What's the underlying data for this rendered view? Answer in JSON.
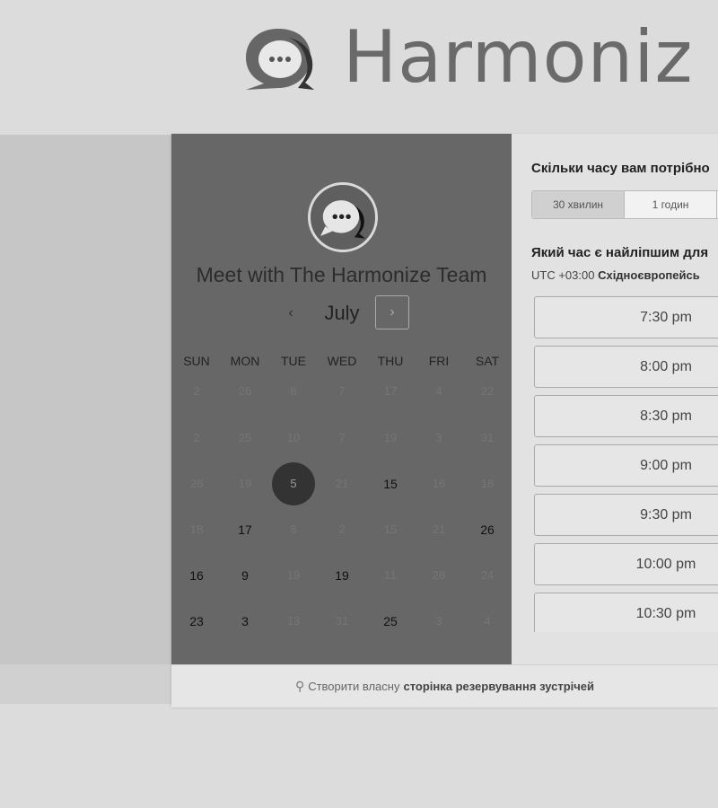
{
  "brand": {
    "name": "Harmoniz"
  },
  "widget": {
    "title": "Meet with The Harmonize Team",
    "month": "July",
    "prev_glyph": "‹",
    "next_glyph": "›",
    "days_of_week": [
      "SUN",
      "MON",
      "TUE",
      "WED",
      "THU",
      "FRI",
      "SAT"
    ],
    "calendar_rows": [
      [
        {
          "d": "2",
          "s": "muted"
        },
        {
          "d": "26",
          "s": "muted"
        },
        {
          "d": "8",
          "s": "muted"
        },
        {
          "d": "7",
          "s": "muted"
        },
        {
          "d": "17",
          "s": "muted"
        },
        {
          "d": "4",
          "s": "muted"
        },
        {
          "d": "22",
          "s": "muted"
        }
      ],
      [
        {
          "d": "2",
          "s": "muted"
        },
        {
          "d": "25",
          "s": "muted"
        },
        {
          "d": "10",
          "s": "muted"
        },
        {
          "d": "7",
          "s": "muted"
        },
        {
          "d": "19",
          "s": "muted"
        },
        {
          "d": "3",
          "s": "muted"
        },
        {
          "d": "31",
          "s": "muted"
        }
      ],
      [
        {
          "d": "26",
          "s": "muted"
        },
        {
          "d": "19",
          "s": "muted"
        },
        {
          "d": "5",
          "s": "selected"
        },
        {
          "d": "21",
          "s": "muted"
        },
        {
          "d": "15",
          "s": "avail"
        },
        {
          "d": "16",
          "s": "muted"
        },
        {
          "d": "18",
          "s": "muted"
        }
      ],
      [
        {
          "d": "18",
          "s": "muted"
        },
        {
          "d": "17",
          "s": "avail"
        },
        {
          "d": "8",
          "s": "muted"
        },
        {
          "d": "2",
          "s": "muted"
        },
        {
          "d": "15",
          "s": "muted"
        },
        {
          "d": "21",
          "s": "muted"
        },
        {
          "d": "26",
          "s": "avail"
        }
      ],
      [
        {
          "d": "16",
          "s": "avail"
        },
        {
          "d": "9",
          "s": "avail"
        },
        {
          "d": "19",
          "s": "muted"
        },
        {
          "d": "19",
          "s": "avail"
        },
        {
          "d": "11",
          "s": "muted"
        },
        {
          "d": "28",
          "s": "muted"
        },
        {
          "d": "24",
          "s": "muted"
        }
      ],
      [
        {
          "d": "23",
          "s": "avail"
        },
        {
          "d": "3",
          "s": "avail"
        },
        {
          "d": "13",
          "s": "muted"
        },
        {
          "d": "31",
          "s": "muted"
        },
        {
          "d": "25",
          "s": "avail"
        },
        {
          "d": "3",
          "s": "muted"
        },
        {
          "d": "4",
          "s": "muted"
        }
      ]
    ]
  },
  "booking": {
    "duration_question": "Скільки часу вам потрібно",
    "durations": [
      {
        "label": "30 хвилин",
        "active": true
      },
      {
        "label": "1 годин",
        "active": false
      }
    ],
    "time_question": "Який час є найліпшим для",
    "timezone_offset": "UTC +03:00",
    "timezone_name": "Східноєвропейсь",
    "time_slots": [
      "7:30 pm",
      "8:00 pm",
      "8:30 pm",
      "9:00 pm",
      "9:30 pm",
      "10:00 pm",
      "10:30 pm"
    ]
  },
  "footer": {
    "prefix": "Створити власну",
    "link": "сторінка резервування зустрічей"
  }
}
